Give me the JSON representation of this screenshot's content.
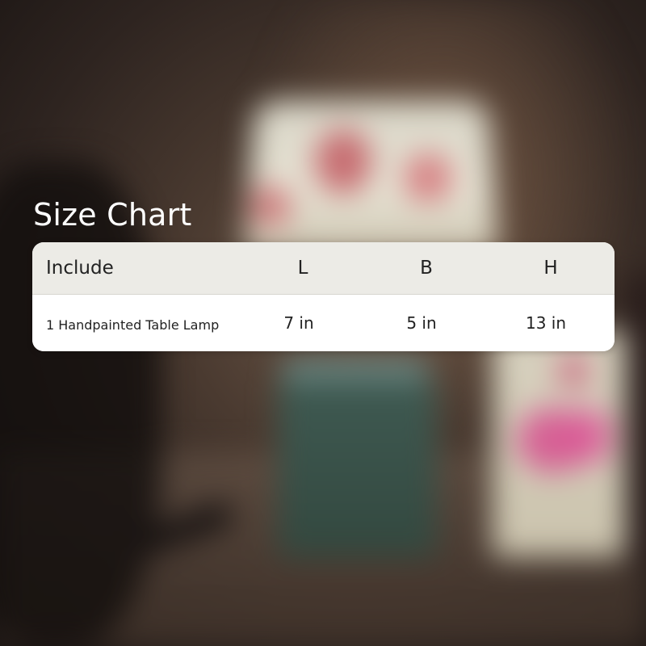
{
  "title": "Size Chart",
  "table": {
    "headers": {
      "item": "Include",
      "length": "L",
      "breadth": "B",
      "height": "H"
    },
    "rows": [
      {
        "item": "1 Handpainted Table Lamp",
        "length": "7 in",
        "breadth": "5 in",
        "height": "13 in"
      }
    ]
  },
  "colors": {
    "title_text": "#ffffff",
    "header_background": "#ecebe6",
    "row_background": "#ffffff",
    "table_text": "#222222"
  }
}
